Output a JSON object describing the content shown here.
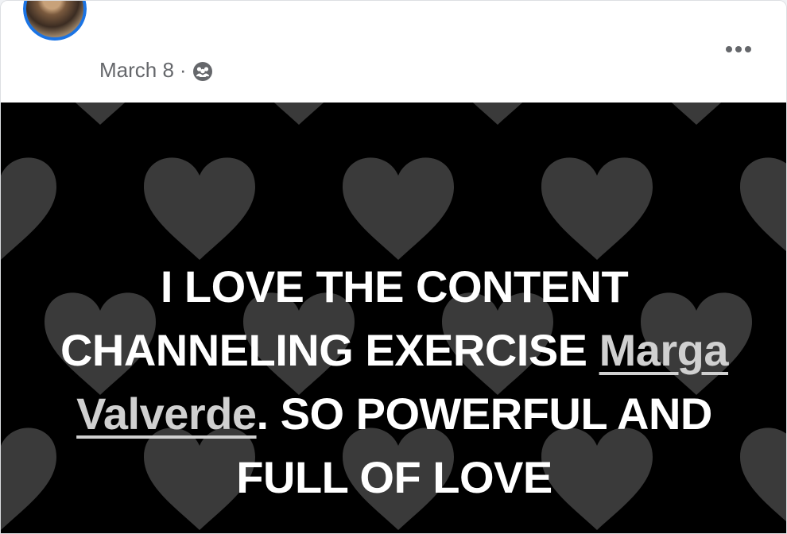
{
  "post": {
    "date": "March 8",
    "separator": "·",
    "audience_icon": "friends-group-icon",
    "more_icon": "more-options-icon",
    "text": {
      "line1": "I LOVE THE CONTENT",
      "line2_prefix": "CHANNELING EXERCISE ",
      "mention_part1": "Marga",
      "mention_part2": "Valverde",
      "line3_suffix": ". SO POWERFUL AND",
      "line4": "FULL OF LOVE"
    },
    "background": {
      "pattern": "hearts",
      "base_color": "#000000",
      "heart_color": "#3a3a3a"
    }
  }
}
